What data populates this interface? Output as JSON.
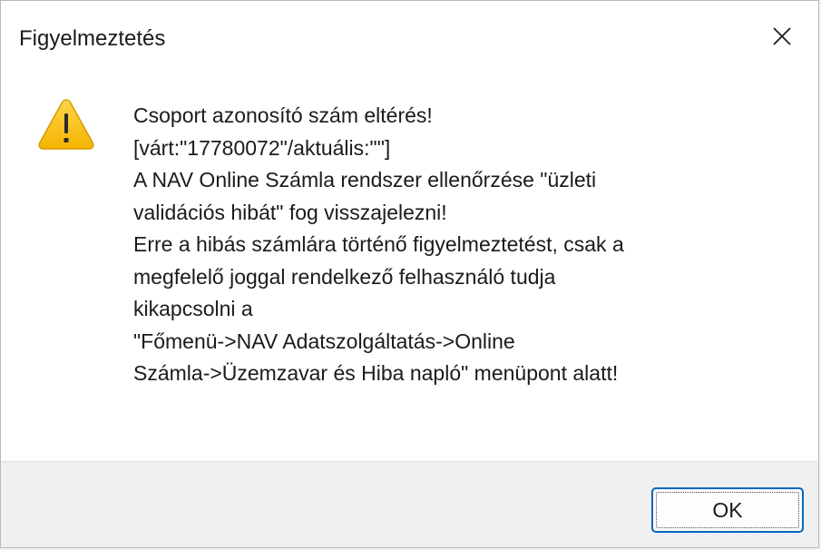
{
  "window": {
    "title": "Figyelmeztetés",
    "close_label": "×"
  },
  "icon": {
    "name": "warning-icon",
    "fill_color": "#f5b800",
    "stroke_color": "#d79b00",
    "glyph": "!"
  },
  "message": {
    "lines": [
      "Csoport azonosító szám eltérés!",
      "[várt:\"17780072\"/aktuális:\"\"]",
      "A NAV Online Számla rendszer ellenőrzése \"üzleti",
      "validációs hibát\" fog visszajelezni!",
      "Erre a hibás számlára történő figyelmeztetést, csak a",
      "megfelelő joggal rendelkező felhasználó tudja",
      "kikapcsolni a",
      "\"Főmenü->NAV Adatszolgáltatás->Online",
      "Számla->Üzemzavar és Hiba napló\" menüpont alatt!"
    ]
  },
  "buttons": {
    "ok_label": "OK"
  },
  "colors": {
    "accent": "#0067c0",
    "footer_bg": "#f0f0f0"
  }
}
